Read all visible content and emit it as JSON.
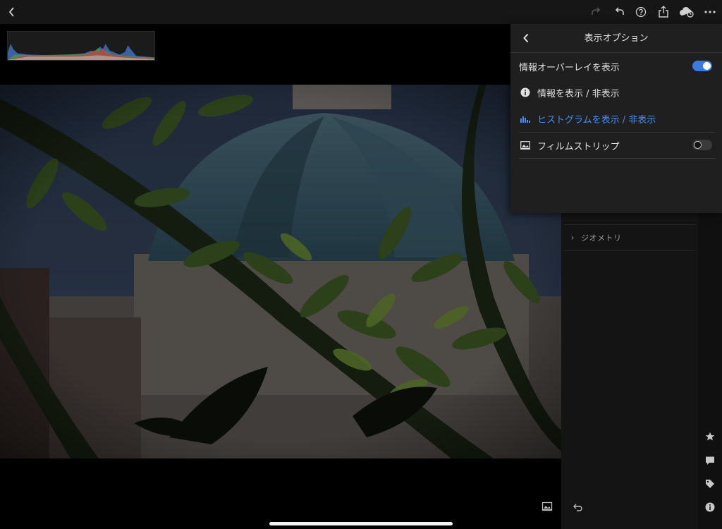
{
  "topbar": {
    "icons": [
      "back-chevron-icon",
      "redo-icon",
      "undo-icon",
      "help-icon",
      "share-icon",
      "cloud-sync-icon",
      "more-icon"
    ]
  },
  "popover": {
    "title": "表示オプション",
    "items": [
      {
        "label": "情報オーバーレイを表示",
        "toggle": true
      },
      {
        "label": "情報を表示 / 非表示",
        "icon": "info-icon"
      },
      {
        "label": "ヒストグラムを表示 / 非表示",
        "icon": "histogram-icon",
        "active": true,
        "color": "#4a8cf0"
      },
      {
        "label": "フィルムストリップ",
        "icon": "filmstrip-icon",
        "toggle": false
      }
    ]
  },
  "side_panel": {
    "section_label": "ジオメトリ"
  },
  "tool_rail": {
    "icons": [
      "star-icon",
      "comment-icon",
      "tag-icon",
      "info-icon"
    ]
  },
  "colors": {
    "accent": "#3b7ae0",
    "panel": "#1f1f1f"
  }
}
